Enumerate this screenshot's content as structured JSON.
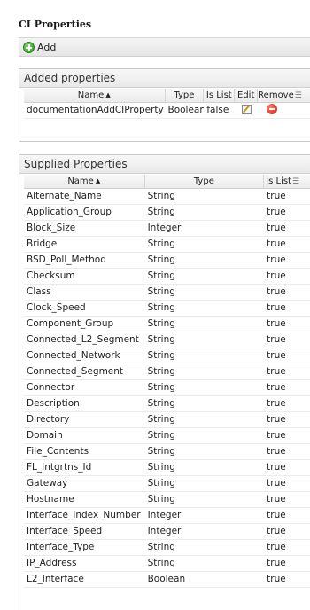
{
  "title": "CI Properties",
  "toolbar": {
    "add_label": "Add"
  },
  "added": {
    "header": "Added properties",
    "columns": [
      "Name",
      "Type",
      "Is List",
      "Edit",
      "Remove"
    ],
    "rows": [
      {
        "name": "documentationAddCIProperty",
        "type": "Boolean",
        "is_list": "false"
      }
    ]
  },
  "supplied": {
    "header": "Supplied Properties",
    "columns": [
      "Name",
      "Type",
      "Is List"
    ],
    "rows": [
      {
        "name": "Alternate_Name",
        "type": "String",
        "is_list": "true"
      },
      {
        "name": "Application_Group",
        "type": "String",
        "is_list": "true"
      },
      {
        "name": "Block_Size",
        "type": "Integer",
        "is_list": "true"
      },
      {
        "name": "Bridge",
        "type": "String",
        "is_list": "true"
      },
      {
        "name": "BSD_Poll_Method",
        "type": "String",
        "is_list": "true"
      },
      {
        "name": "Checksum",
        "type": "String",
        "is_list": "true"
      },
      {
        "name": "Class",
        "type": "String",
        "is_list": "true"
      },
      {
        "name": "Clock_Speed",
        "type": "String",
        "is_list": "true"
      },
      {
        "name": "Component_Group",
        "type": "String",
        "is_list": "true"
      },
      {
        "name": "Connected_L2_Segment",
        "type": "String",
        "is_list": "true"
      },
      {
        "name": "Connected_Network",
        "type": "String",
        "is_list": "true"
      },
      {
        "name": "Connected_Segment",
        "type": "String",
        "is_list": "true"
      },
      {
        "name": "Connector",
        "type": "String",
        "is_list": "true"
      },
      {
        "name": "Description",
        "type": "String",
        "is_list": "true"
      },
      {
        "name": "Directory",
        "type": "String",
        "is_list": "true"
      },
      {
        "name": "Domain",
        "type": "String",
        "is_list": "true"
      },
      {
        "name": "File_Contents",
        "type": "String",
        "is_list": "true"
      },
      {
        "name": "FL_Intgrtns_Id",
        "type": "String",
        "is_list": "true"
      },
      {
        "name": "Gateway",
        "type": "String",
        "is_list": "true"
      },
      {
        "name": "Hostname",
        "type": "String",
        "is_list": "true"
      },
      {
        "name": "Interface_Index_Number",
        "type": "Integer",
        "is_list": "true"
      },
      {
        "name": "Interface_Speed",
        "type": "Integer",
        "is_list": "true"
      },
      {
        "name": "Interface_Type",
        "type": "String",
        "is_list": "true"
      },
      {
        "name": "IP_Address",
        "type": "String",
        "is_list": "true"
      },
      {
        "name": "L2_Interface",
        "type": "Boolean",
        "is_list": "true"
      }
    ]
  }
}
